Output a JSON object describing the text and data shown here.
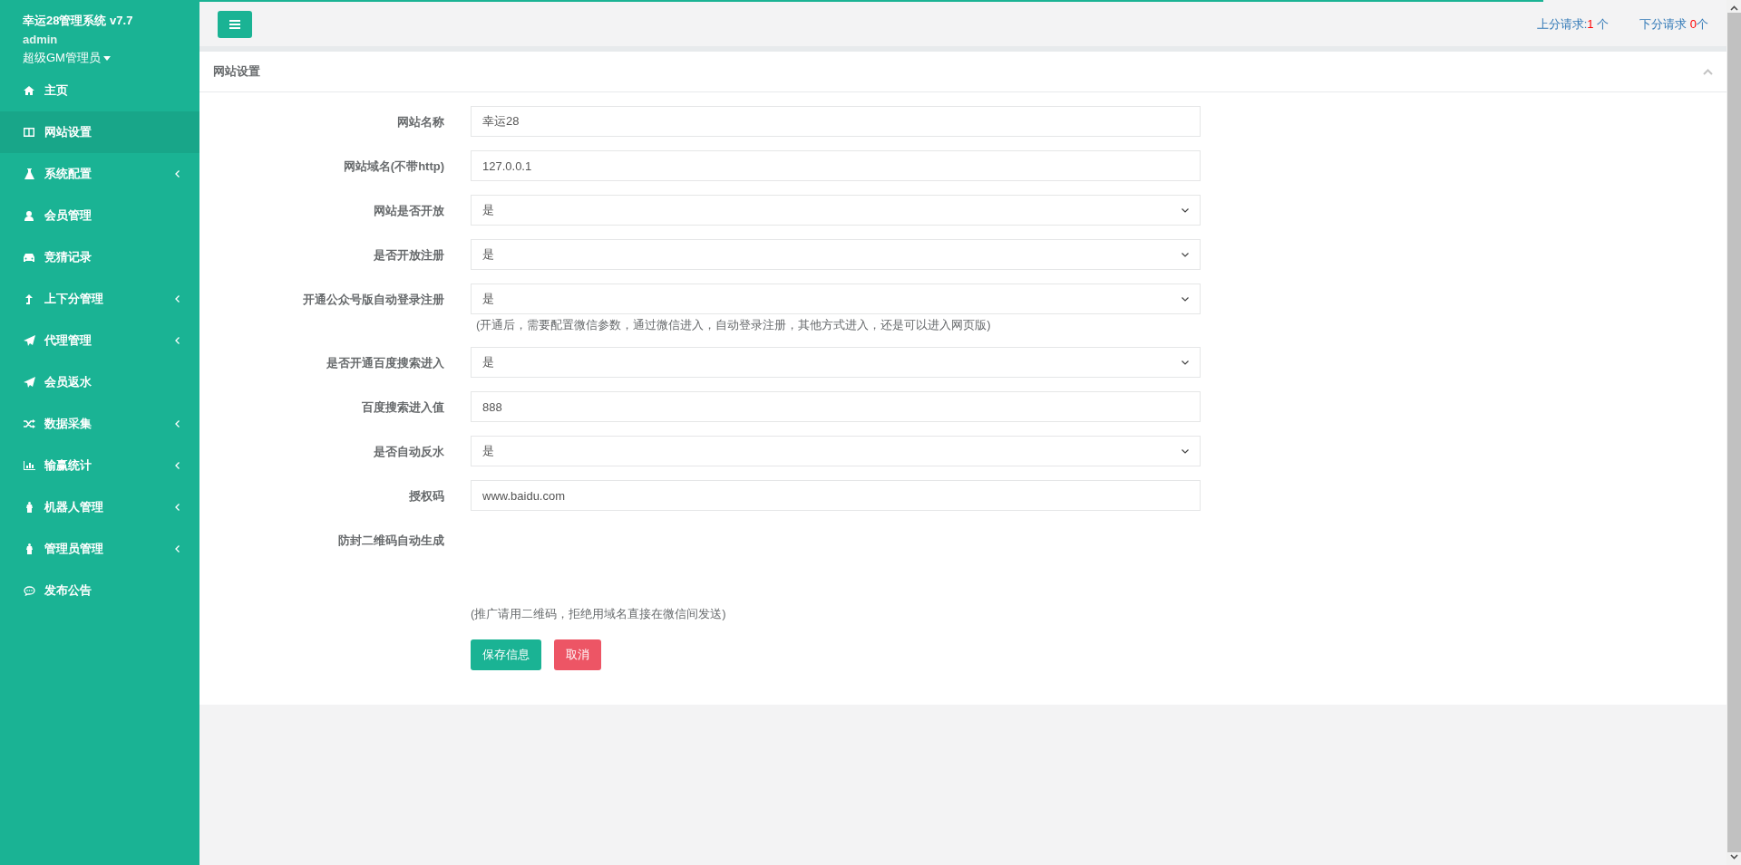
{
  "sidebar": {
    "title": "幸运28管理系统 v7.7",
    "user": "admin",
    "role": "超级GM管理员",
    "items": [
      {
        "label": "主页",
        "selected": false,
        "expandable": false
      },
      {
        "label": "网站设置",
        "selected": true,
        "expandable": false
      },
      {
        "label": "系统配置",
        "selected": false,
        "expandable": true
      },
      {
        "label": "会员管理",
        "selected": false,
        "expandable": false
      },
      {
        "label": "竞猜记录",
        "selected": false,
        "expandable": false
      },
      {
        "label": "上下分管理",
        "selected": false,
        "expandable": true
      },
      {
        "label": "代理管理",
        "selected": false,
        "expandable": true
      },
      {
        "label": "会员返水",
        "selected": false,
        "expandable": false
      },
      {
        "label": "数据采集",
        "selected": false,
        "expandable": true
      },
      {
        "label": "输赢统计",
        "selected": false,
        "expandable": true
      },
      {
        "label": "机器人管理",
        "selected": false,
        "expandable": true
      },
      {
        "label": "管理员管理",
        "selected": false,
        "expandable": true
      },
      {
        "label": "发布公告",
        "selected": false,
        "expandable": false
      }
    ]
  },
  "load_progress": {
    "level": 0.88
  },
  "topbar": {
    "up_label": "上分请求:",
    "up_count": "1",
    "up_unit": " 个",
    "down_label": "下分请求 ",
    "down_count": "0",
    "down_unit": "个"
  },
  "panel": {
    "title": "网站设置",
    "fields": [
      {
        "label": "网站名称",
        "kind": "text",
        "value": "幸运28"
      },
      {
        "label": "网站域名(不带http)",
        "kind": "text",
        "value": "127.0.0.1"
      },
      {
        "label": "网站是否开放",
        "kind": "select",
        "value": "是"
      },
      {
        "label": "是否开放注册",
        "kind": "select",
        "value": "是"
      },
      {
        "label": "开通公众号版自动登录注册",
        "kind": "select",
        "value": "是",
        "hint": "(开通后，需要配置微信参数，通过微信进入，自动登录注册，其他方式进入，还是可以进入网页版)"
      },
      {
        "label": "是否开通百度搜索进入",
        "kind": "select",
        "value": "是"
      },
      {
        "label": "百度搜索进入值",
        "kind": "text",
        "value": "888"
      },
      {
        "label": "是否自动反水",
        "kind": "select",
        "value": "是"
      },
      {
        "label": "授权码",
        "kind": "text",
        "value": "www.baidu.com"
      },
      {
        "label": "防封二维码自动生成",
        "kind": "qr",
        "hint": "(推广请用二维码，拒绝用域名直接在微信间发送)"
      }
    ],
    "buttons": [
      {
        "label": "保存信息",
        "kind": "primary"
      },
      {
        "label": "取消",
        "kind": "danger"
      }
    ]
  }
}
